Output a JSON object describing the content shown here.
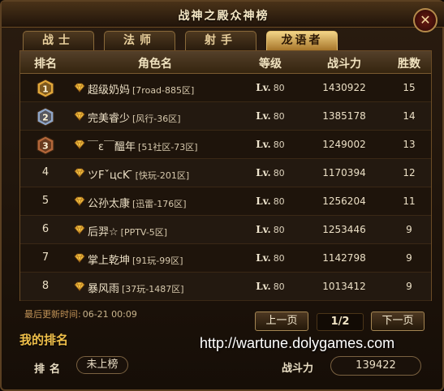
{
  "window": {
    "title": "战神之殿众神榜",
    "close_label": "✕"
  },
  "tabs": [
    {
      "label": "战士",
      "active": false
    },
    {
      "label": "法师",
      "active": false
    },
    {
      "label": "射手",
      "active": false
    },
    {
      "label": "龙语者",
      "active": true
    }
  ],
  "table": {
    "headers": {
      "rank": "排名",
      "name": "角色名",
      "level": "等级",
      "power": "战斗力",
      "wins": "胜数"
    },
    "level_prefix": "Lv.",
    "rows": [
      {
        "rank": "1",
        "name": "超级奶妈",
        "server": "[7road-885区]",
        "level": "80",
        "power": "1430922",
        "wins": "15"
      },
      {
        "rank": "2",
        "name": "完美睿少",
        "server": "[风行-36区]",
        "level": "80",
        "power": "1385178",
        "wins": "14"
      },
      {
        "rank": "3",
        "name": "￣ε￣醞年",
        "server": "[51社区-73区]",
        "level": "80",
        "power": "1249002",
        "wins": "13"
      },
      {
        "rank": "4",
        "name": "ツFˇцcK ̄",
        "server": "[快玩-201区]",
        "level": "80",
        "power": "1170394",
        "wins": "12"
      },
      {
        "rank": "5",
        "name": "公孙太康",
        "server": "[迅雷-176区]",
        "level": "80",
        "power": "1256204",
        "wins": "11"
      },
      {
        "rank": "6",
        "name": "后羿☆",
        "server": "[PPTV-5区]",
        "level": "80",
        "power": "1253446",
        "wins": "9"
      },
      {
        "rank": "7",
        "name": "掌上乾坤",
        "server": "[91玩-99区]",
        "level": "80",
        "power": "1142798",
        "wins": "9"
      },
      {
        "rank": "8",
        "name": "暴风雨",
        "server": "[37玩-1487区]",
        "level": "80",
        "power": "1013412",
        "wins": "9"
      }
    ]
  },
  "last_update": {
    "label": "最后更新时间:",
    "time": "06-21 00:09"
  },
  "pager": {
    "prev_label": "上一页",
    "page_info": "1/2",
    "next_label": "下一页"
  },
  "my_ranking": {
    "title": "我的排名",
    "rank_label": "排名",
    "rank_value": "未上榜",
    "power_label": "战斗力",
    "power_value": "139422"
  },
  "watermark": "http://wartune.dolygames.com",
  "colors": {
    "gold_medal": "#e2a83a",
    "silver_medal": "#8fa6c8",
    "bronze_medal": "#b4673a",
    "gem": "#f2c040",
    "accent_title": "#f0c04a"
  },
  "icons": {
    "rank_medal": "rank-medal-icon",
    "gem": "gem-icon",
    "close": "close-icon"
  }
}
